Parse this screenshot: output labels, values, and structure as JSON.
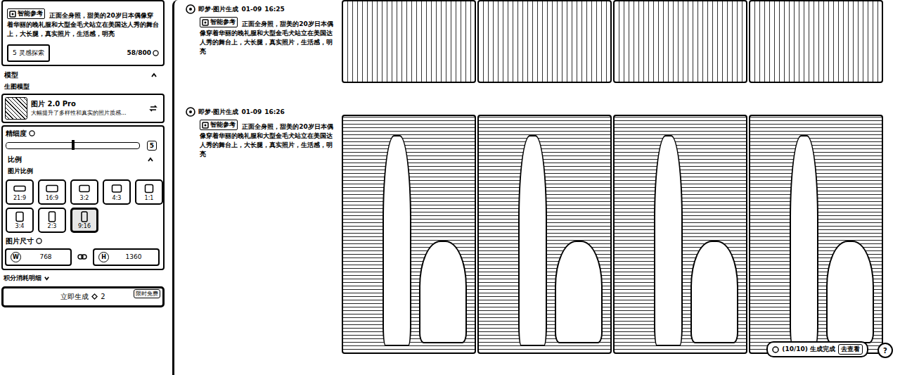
{
  "sidebar": {
    "prompt": {
      "tag": "智能参考",
      "text": "正面全身照，甜美的20岁日本偶像穿着华丽的晚礼服和大型金毛犬站立在美国达人秀的舞台上，大长腿，真实照片，生活感，明亮",
      "inspiration_button": "5 灵感探索",
      "counter": "58/800"
    },
    "model_section": {
      "title": "模型",
      "expanded": true,
      "label": "生图模型",
      "model_name": "图片 2.0 Pro",
      "model_desc": "大幅提升了多样性和真实的照片质感..."
    },
    "detail": {
      "label": "精细度",
      "level": 0.5,
      "value": "5"
    },
    "ratio_section": {
      "title": "比例",
      "expanded": true,
      "label": "图片比例",
      "ratios": [
        {
          "label": "21:9",
          "selected": false
        },
        {
          "label": "16:9",
          "selected": false
        },
        {
          "label": "3:2",
          "selected": false
        },
        {
          "label": "4:3",
          "selected": false
        },
        {
          "label": "1:1",
          "selected": false
        },
        {
          "label": "3:4",
          "selected": false
        },
        {
          "label": "2:3",
          "selected": false
        },
        {
          "label": "9:16",
          "selected": true
        }
      ]
    },
    "size": {
      "label": "图片尺寸",
      "width_label": "W",
      "width": "768",
      "height_label": "H",
      "height": "1360"
    },
    "cost": {
      "label": "积分消耗明细",
      "expanded": false
    },
    "generate": {
      "label": "立即生成",
      "cost": "2",
      "badge": "限时免费"
    }
  },
  "feed": [
    {
      "source": "即梦·图片生成",
      "date": "01-09",
      "time": "16:25",
      "tag": "智能参考",
      "prompt": "正面全身照，甜美的20岁日本偶像穿着华丽的晚礼服和大型金毛犬站立在美国达人秀的舞台上，大长腿，真实照片，生活感，明亮",
      "images": 4
    },
    {
      "source": "即梦·图片生成",
      "date": "01-09",
      "time": "16:26",
      "tag": "智能参考",
      "prompt": "正面全身照，甜美的20岁日本偶像穿着华丽的晚礼服和大型金毛犬站立在美国达人秀的舞台上，大长腿，真实照片，生活感，明亮",
      "images": 4
    }
  ],
  "status": {
    "text": "(10/10) 生成完成",
    "link": "去查看"
  },
  "help": "?"
}
